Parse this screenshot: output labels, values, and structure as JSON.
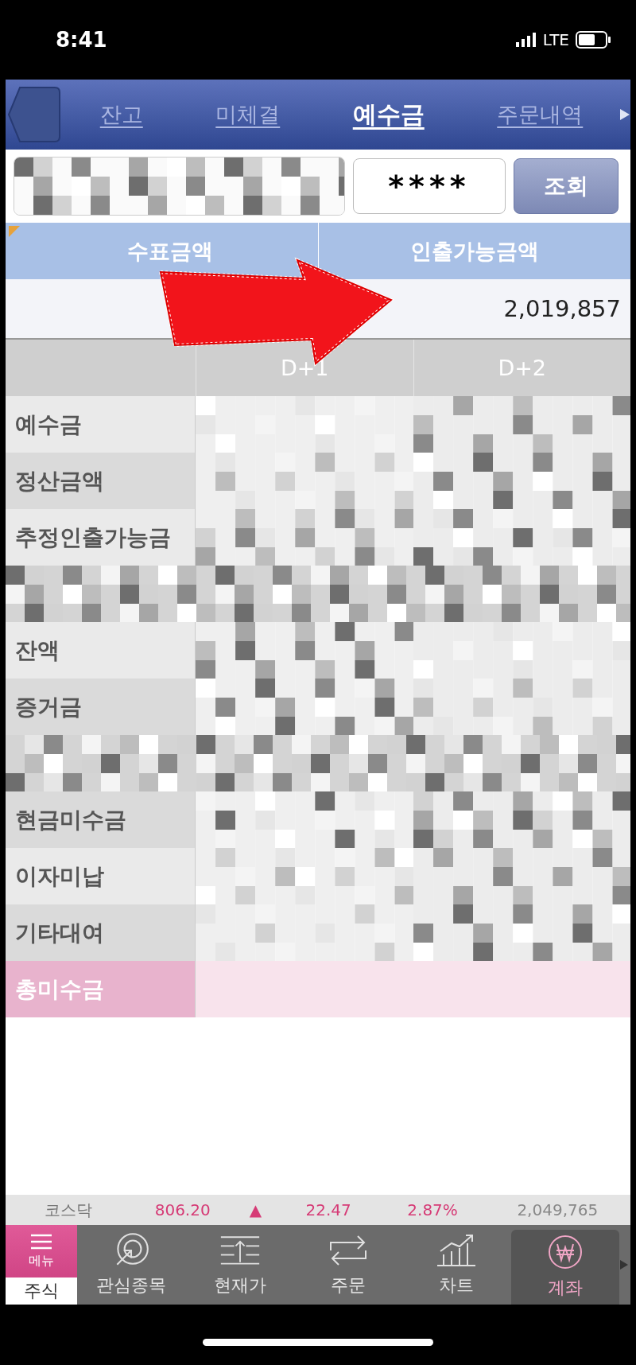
{
  "status_bar": {
    "time": "8:41",
    "network": "LTE"
  },
  "tabs": [
    {
      "label": "잔고",
      "selected": false
    },
    {
      "label": "미체결",
      "selected": false
    },
    {
      "label": "예수금",
      "selected": true
    },
    {
      "label": "주문내역",
      "selected": false
    }
  ],
  "account": {
    "password": "****",
    "query_button": "조회"
  },
  "summary": {
    "columns": [
      "수표금액",
      "인출가능금액"
    ],
    "withdrawable_amount": "2,019,857"
  },
  "table": {
    "columns": [
      "D+1",
      "D+2"
    ],
    "rows": [
      {
        "kind": "normal",
        "label": "예수금"
      },
      {
        "kind": "normal",
        "label": "정산금액"
      },
      {
        "kind": "normal",
        "label": "추정인출가능금"
      },
      {
        "kind": "blank"
      },
      {
        "kind": "normal",
        "label": "잔액"
      },
      {
        "kind": "normal",
        "label": "증거금"
      },
      {
        "kind": "blank"
      },
      {
        "kind": "normal",
        "label": "현금미수금"
      },
      {
        "kind": "normal",
        "label": "이자미납"
      },
      {
        "kind": "normal",
        "label": "기타대여"
      },
      {
        "kind": "total",
        "label": "총미수금"
      }
    ]
  },
  "ticker": {
    "index": "코스닥",
    "value": "806.20",
    "arrow": "▲",
    "change": "22.47",
    "rate": "2.87%",
    "volume": "2,049,765"
  },
  "bottom_nav": [
    {
      "kind": "menu",
      "icon_label": "메뉴",
      "label": "주식",
      "selected": false
    },
    {
      "kind": "watch",
      "label": "관심종목",
      "selected": false
    },
    {
      "kind": "price",
      "label": "현재가",
      "selected": false
    },
    {
      "kind": "order",
      "label": "주문",
      "selected": false
    },
    {
      "kind": "chart",
      "label": "차트",
      "selected": false
    },
    {
      "kind": "account",
      "label": "계좌",
      "selected": true
    }
  ]
}
